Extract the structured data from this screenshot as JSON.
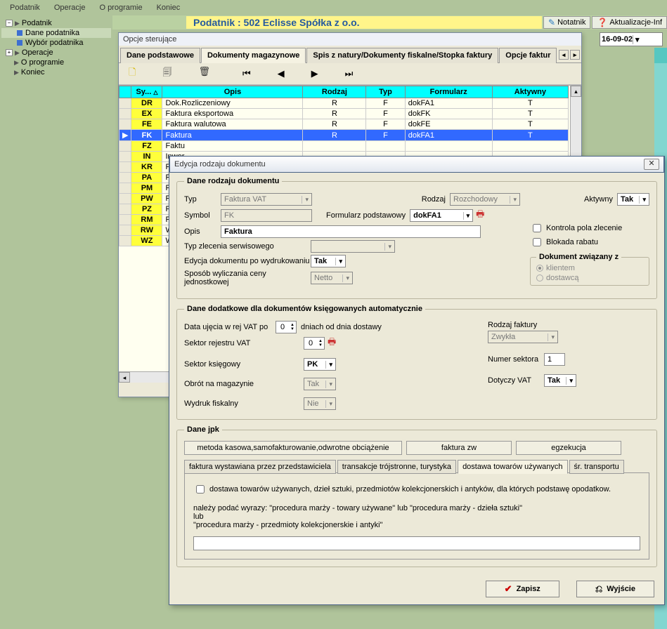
{
  "menu": {
    "m1": "Podatnik",
    "m2": "Operacje",
    "m3": "O programie",
    "m4": "Koniec"
  },
  "tree": {
    "root": "Podatnik",
    "dane": "Dane podatnika",
    "wybor": "Wybór podatnika",
    "operacje": "Operacje",
    "oprog": "O programie",
    "koniec": "Koniec"
  },
  "top": {
    "title": "Podatnik : 502 Eclisse Spółka z o.o.",
    "notatnik": "Notatnik",
    "aktual": "Aktualizacje-Inf",
    "date": "16-09-02"
  },
  "opcje": {
    "head": "Opcje sterujące",
    "tabs": {
      "t1": "Dane podstawowe",
      "t2": "Dokumenty magazynowe",
      "t3": "Spis z natury/Dokumenty fiskalne/Stopka faktury",
      "t4": "Opcje faktur"
    },
    "cols": {
      "c1": "Sy...",
      "c2": "Opis",
      "c3": "Rodzaj",
      "c4": "Typ",
      "c5": "Formularz",
      "c6": "Aktywny"
    },
    "rows": [
      {
        "s": "DR",
        "o": "Dok.Rozliczeniowy",
        "r": "R",
        "t": "F",
        "f": "dokFA1",
        "a": "T"
      },
      {
        "s": "EX",
        "o": "Faktura eksportowa",
        "r": "R",
        "t": "F",
        "f": "dokFK",
        "a": "T"
      },
      {
        "s": "FE",
        "o": "Faktura walutowa",
        "r": "R",
        "t": "F",
        "f": "dokFE",
        "a": "T"
      },
      {
        "s": "FK",
        "o": "Faktura",
        "r": "R",
        "t": "F",
        "f": "dokFA1",
        "a": "T"
      },
      {
        "s": "FZ",
        "o": "Faktu",
        "r": "",
        "t": "",
        "f": "",
        "a": ""
      },
      {
        "s": "IN",
        "o": "Inwer",
        "r": "",
        "t": "",
        "f": "",
        "a": ""
      },
      {
        "s": "KR",
        "o": "Faktu",
        "r": "",
        "t": "",
        "f": "",
        "a": ""
      },
      {
        "s": "PA",
        "o": "Parag",
        "r": "",
        "t": "",
        "f": "",
        "a": ""
      },
      {
        "s": "PM",
        "o": "Przes",
        "r": "",
        "t": "",
        "f": "",
        "a": ""
      },
      {
        "s": "PW",
        "o": "Przyc",
        "r": "",
        "t": "",
        "f": "",
        "a": ""
      },
      {
        "s": "PZ",
        "o": "Przyc",
        "r": "",
        "t": "",
        "f": "",
        "a": ""
      },
      {
        "s": "RM",
        "o": "Przes",
        "r": "",
        "t": "",
        "f": "",
        "a": ""
      },
      {
        "s": "RW",
        "o": "Wyda",
        "r": "",
        "t": "",
        "f": "",
        "a": ""
      },
      {
        "s": "WZ",
        "o": "Wyda",
        "r": "",
        "t": "",
        "f": "",
        "a": ""
      }
    ]
  },
  "dlg": {
    "title": "Edycja rodzaju dokumentu",
    "fs1": "Dane rodzaju dokumentu",
    "typ_l": "Typ",
    "typ_v": "Faktura VAT",
    "rodzaj_l": "Rodzaj",
    "rodzaj_v": "Rozchodowy",
    "aktywny_l": "Aktywny",
    "aktywny_v": "Tak",
    "symbol_l": "Symbol",
    "symbol_v": "FK",
    "formpod_l": "Formularz podstawowy",
    "formpod_v": "dokFA1",
    "opis_l": "Opis",
    "opis_v": "Faktura",
    "typzlec_l": "Typ zlecenia serwisowego",
    "eddok_l": "Edycja dokumentu po wydrukowaniu",
    "eddok_v": "Tak",
    "sposob_l": "Sposób wyliczania ceny jednostkowej",
    "sposob_v": "Netto",
    "ck_kontrola": "Kontrola pola zlecenie",
    "ck_blokada": "Blokada rabatu",
    "fs_dokzw": "Dokument związany z",
    "rad_klient": "klientem",
    "rad_dost": "dostawcą",
    "fs2": "Dane dodatkowe dla dokumentów księgowanych automatycznie",
    "dataujecia_l": "Data ujęcia w rej VAT po",
    "dataujecia_v": "0",
    "dataujecia_suf": "dniach od dnia dostawy",
    "rodzfak_l": "Rodzaj faktury",
    "rodzfak_v": "Zwykła",
    "sektorrej_l": "Sektor rejestru VAT",
    "sektorrej_v": "0",
    "sektorks_l": "Sektor księgowy",
    "sektorks_v": "PK",
    "numersek_l": "Numer sektora",
    "numersek_v": "1",
    "obrot_l": "Obrót na magazynie",
    "obrot_v": "Tak",
    "dotyczy_l": "Dotyczy VAT",
    "dotyczy_v": "Tak",
    "wydruk_l": "Wydruk fiskalny",
    "wydruk_v": "Nie",
    "fs3": "Dane jpk",
    "jpk_b1": "metoda kasowa,samofakturowanie,odwrotne obciążenie",
    "jpk_b2": "faktura zw",
    "jpk_b3": "egzekucja",
    "jpk_t1": "faktura wystawiana przez przedstawiciela",
    "jpk_t2": "transakcje trójstronne, turystyka",
    "jpk_t3": "dostawa towarów używanych",
    "jpk_t4": "śr. transportu",
    "jpk_ck": "dostawa towarów używanych, dzieł sztuki, przedmiotów kolekcjonerskich i antyków, dla których podstawę opodatkow.",
    "jpk_txt1": "należy podać wyrazy: \"procedura marży - towary używane\" lub \"procedura marży - dzieła sztuki\"",
    "jpk_txt2": "lub",
    "jpk_txt3": "\"procedura marży - przedmioty kolekcjonerskie i antyki\"",
    "zapisz": "Zapisz",
    "wyjscie": "Wyjście"
  }
}
